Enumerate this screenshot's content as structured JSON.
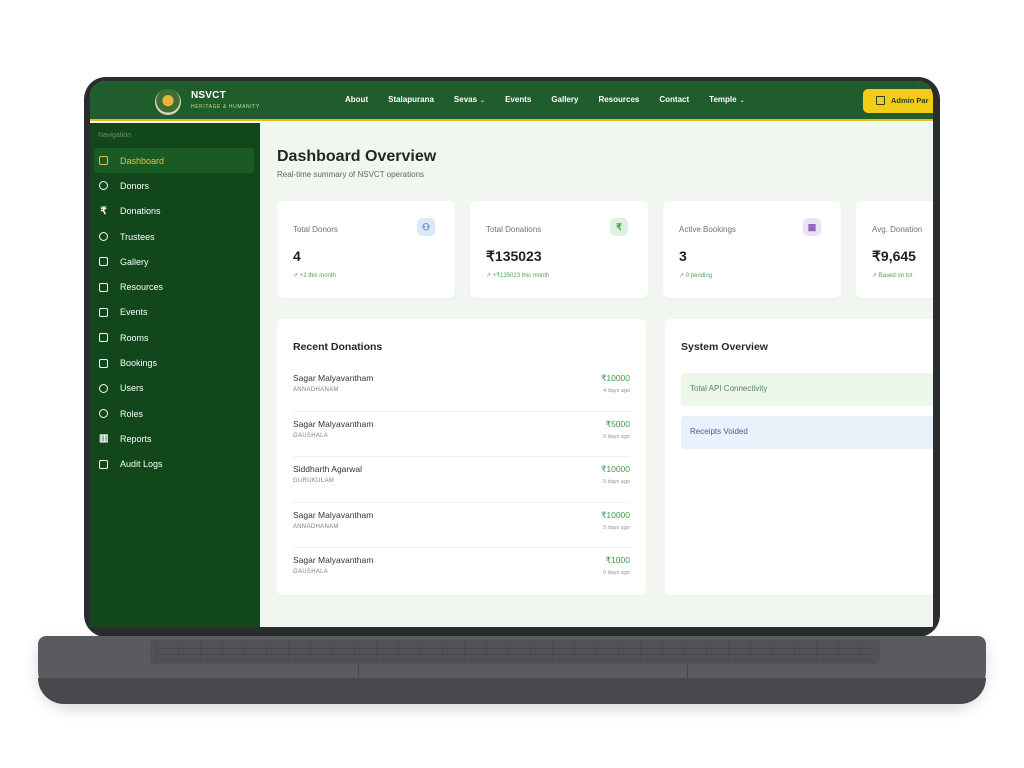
{
  "brand": {
    "name": "NSVCT",
    "tagline": "HERITAGE & HUMANITY"
  },
  "topnav": {
    "links": [
      {
        "label": "About"
      },
      {
        "label": "Stalapurana"
      },
      {
        "label": "Sevas",
        "has_dropdown": true
      },
      {
        "label": "Events"
      },
      {
        "label": "Gallery"
      },
      {
        "label": "Resources"
      },
      {
        "label": "Contact"
      },
      {
        "label": "Temple",
        "has_dropdown": true
      }
    ],
    "admin_button": "Admin Par"
  },
  "sidebar": {
    "heading": "Navigation",
    "items": [
      {
        "label": "Dashboard",
        "icon": "dashboard-icon",
        "active": true
      },
      {
        "label": "Donors",
        "icon": "users-icon"
      },
      {
        "label": "Donations",
        "icon": "rupee-icon"
      },
      {
        "label": "Trustees",
        "icon": "user-check-icon"
      },
      {
        "label": "Gallery",
        "icon": "image-icon"
      },
      {
        "label": "Resources",
        "icon": "folder-icon"
      },
      {
        "label": "Events",
        "icon": "calendar-icon"
      },
      {
        "label": "Rooms",
        "icon": "building-icon"
      },
      {
        "label": "Bookings",
        "icon": "booking-icon"
      },
      {
        "label": "Users",
        "icon": "users-icon"
      },
      {
        "label": "Roles",
        "icon": "shield-icon"
      },
      {
        "label": "Reports",
        "icon": "bar-chart-icon"
      },
      {
        "label": "Audit Logs",
        "icon": "file-text-icon"
      }
    ]
  },
  "page": {
    "title": "Dashboard Overview",
    "subtitle": "Real-time summary of NSVCT operations"
  },
  "stats": [
    {
      "label": "Total Donors",
      "value": "4",
      "trend": "↗ +2 this month",
      "icon": "users-icon",
      "icon_glyph": "⚇",
      "icon_bg": "#dbe8f7",
      "icon_color": "#4a78b5"
    },
    {
      "label": "Total Donations",
      "value": "₹135023",
      "trend": "↗ +₹135023 this month",
      "icon": "rupee-icon",
      "icon_glyph": "₹",
      "icon_bg": "#dff1e0",
      "icon_color": "#3d9b4a"
    },
    {
      "label": "Active Bookings",
      "value": "3",
      "trend": "↗ 0 pending",
      "icon": "calendar-icon",
      "icon_glyph": "▦",
      "icon_bg": "#ece1f6",
      "icon_color": "#8a5cc0"
    },
    {
      "label": "Avg. Donation",
      "value": "₹9,645",
      "trend": "↗ Based on tot",
      "icon": "",
      "icon_glyph": "",
      "icon_bg": "#ffffff",
      "icon_color": "#ffffff"
    }
  ],
  "recent_donations": {
    "title": "Recent Donations",
    "rows": [
      {
        "name": "Sagar Malyavantham",
        "category": "ANNADHANAM",
        "amount": "₹10000",
        "time": "4 days ago"
      },
      {
        "name": "Sagar Malyavantham",
        "category": "GAUSHALA",
        "amount": "₹5000",
        "time": "5 days ago"
      },
      {
        "name": "Siddharth Agarwal",
        "category": "GURUKULAM",
        "amount": "₹10000",
        "time": "5 days ago"
      },
      {
        "name": "Sagar Malyavantham",
        "category": "ANNADHANAM",
        "amount": "₹10000",
        "time": "5 days ago"
      },
      {
        "name": "Sagar Malyavantham",
        "category": "GAUSHALA",
        "amount": "₹1000",
        "time": "6 days ago"
      }
    ]
  },
  "system_overview": {
    "title": "System Overview",
    "rows": [
      {
        "label": "Total API Connectivity",
        "bg": "#ecf7ea",
        "color": "#4d8a55"
      },
      {
        "label": "Receipts Voided",
        "bg": "#eaf1fb",
        "color": "#4a5d92"
      }
    ]
  },
  "colors": {
    "header": "#1f5e2c",
    "sidebar": "#11471b",
    "accent": "#f2cc16",
    "positive": "#3e9b4a"
  }
}
